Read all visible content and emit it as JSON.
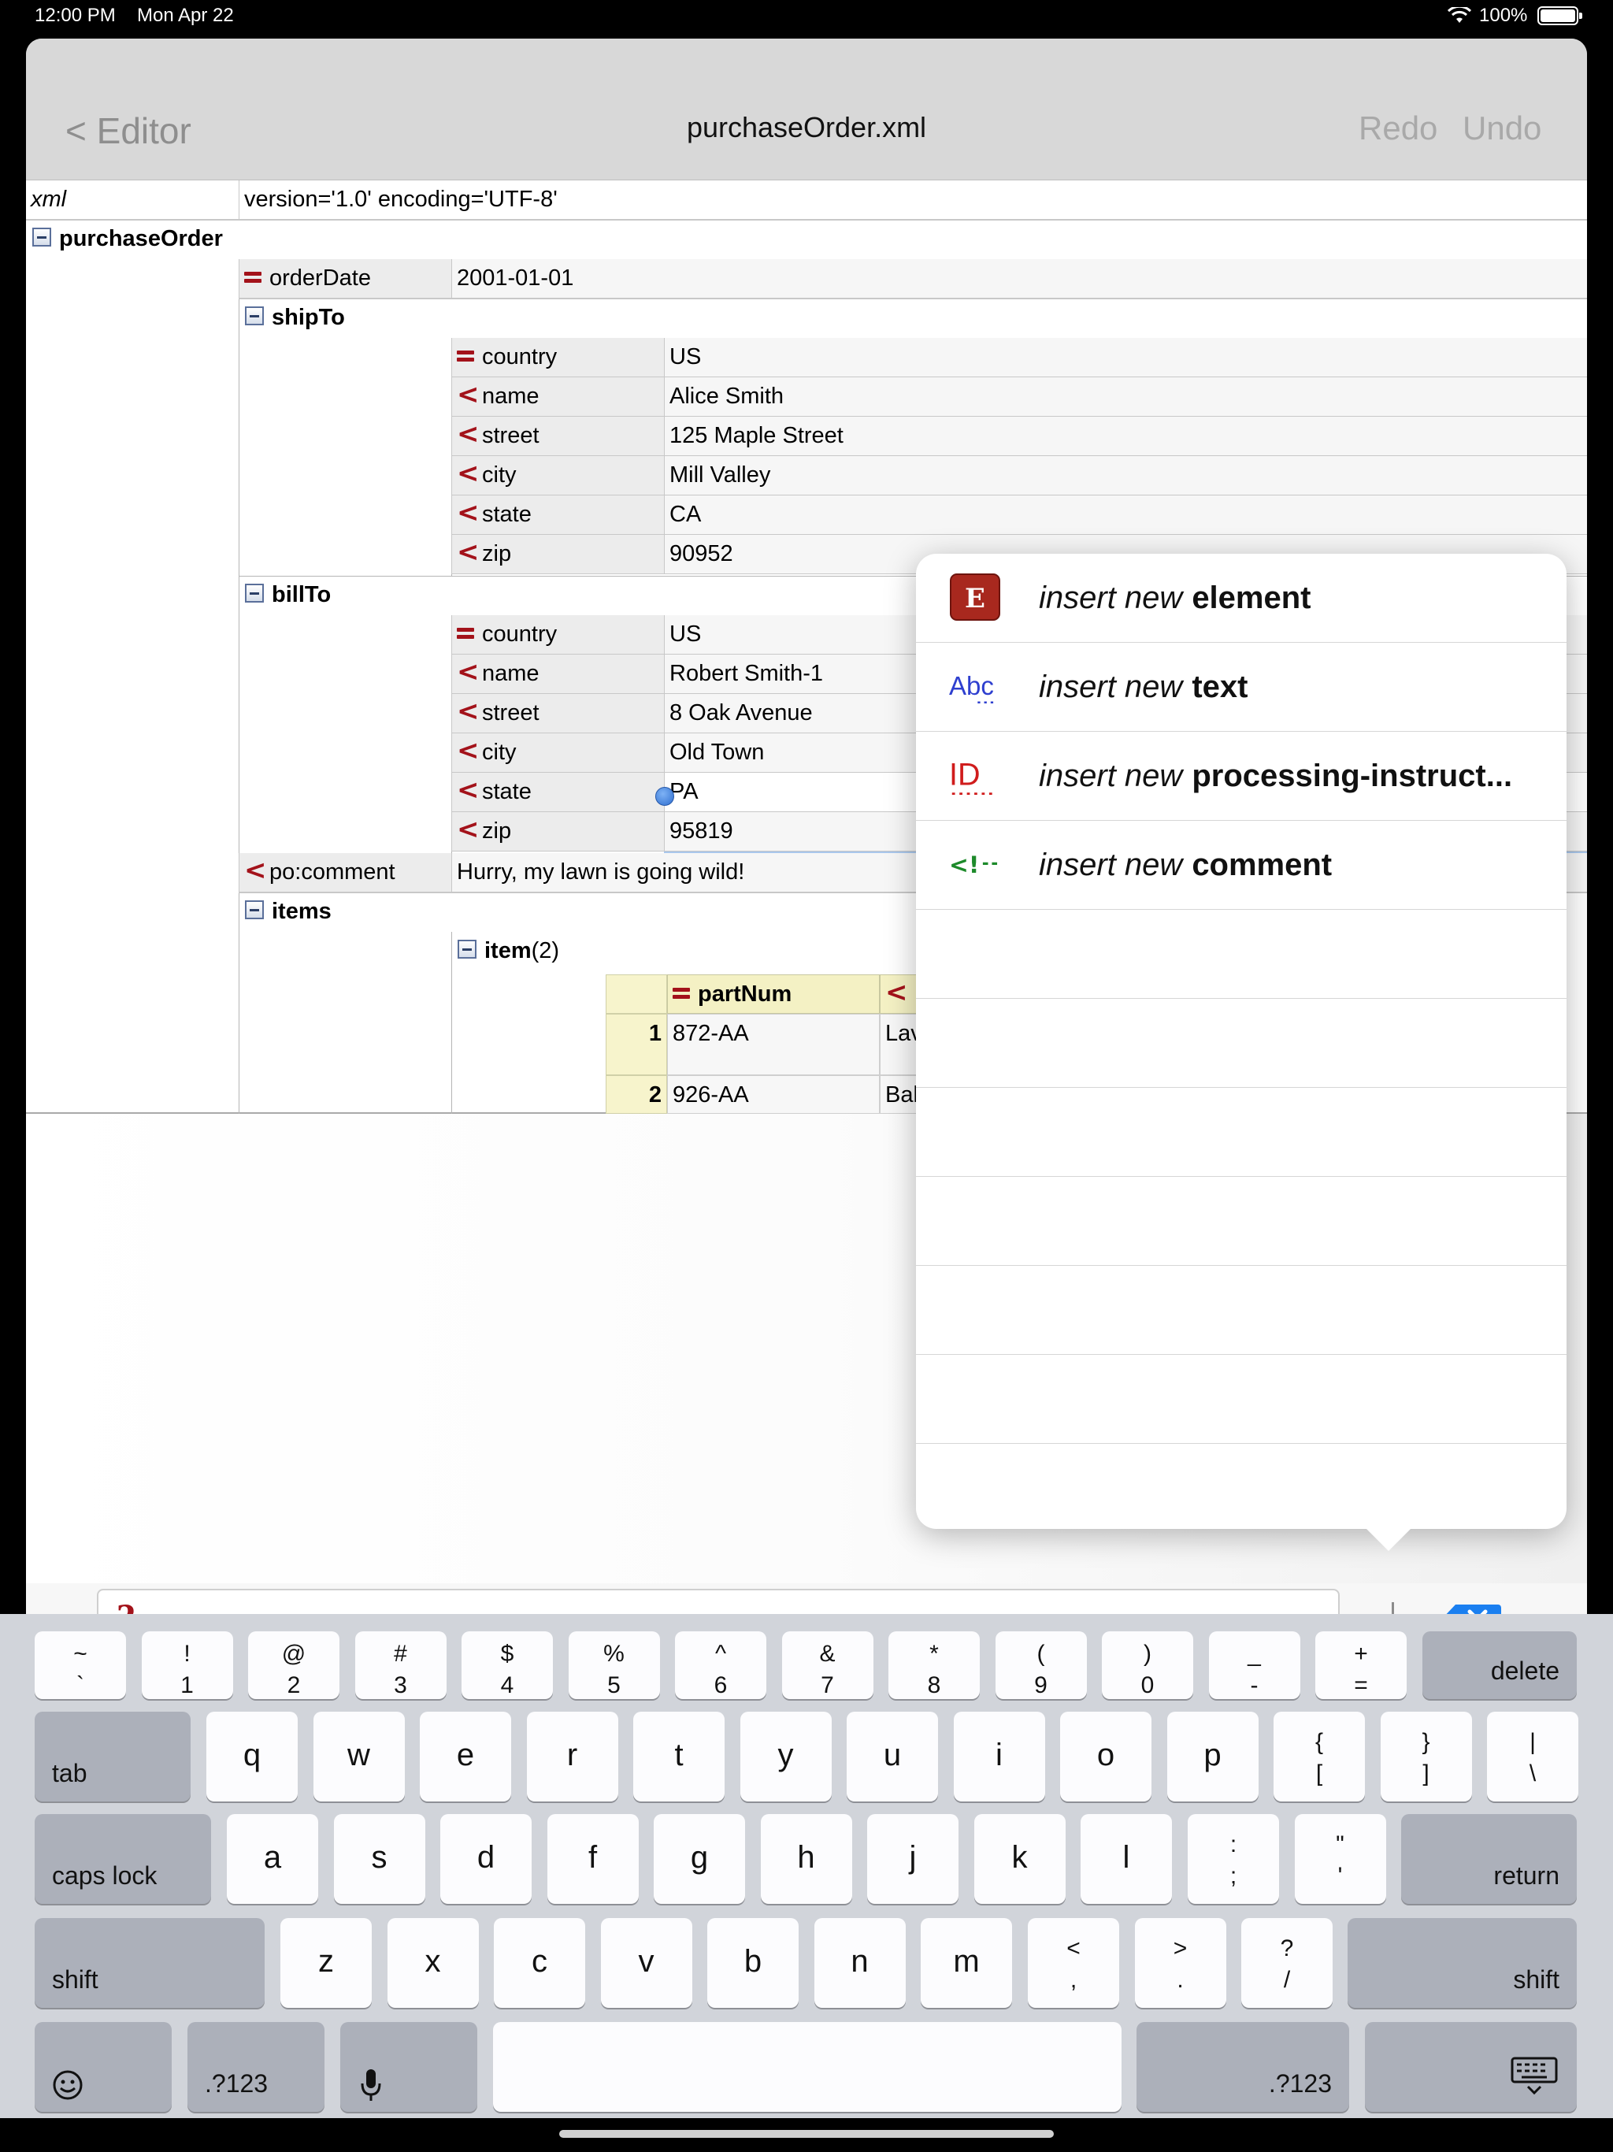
{
  "status": {
    "time": "12:00 PM",
    "date": "Mon Apr 22",
    "battery": "100%"
  },
  "nav": {
    "back": "< Editor",
    "title": "purchaseOrder.xml",
    "redo": "Redo",
    "undo": "Undo"
  },
  "xml": {
    "label": "xml",
    "value": "version='1.0' encoding='UTF-8'"
  },
  "tree": {
    "root": "purchaseOrder",
    "orderDate": {
      "name": "orderDate",
      "value": "2001-01-01"
    },
    "shipTo": {
      "label": "shipTo",
      "rows": [
        {
          "icon": "attribute-icon",
          "name": "country",
          "value": "US"
        },
        {
          "icon": "element-icon",
          "name": "name",
          "value": "Alice Smith"
        },
        {
          "icon": "element-icon",
          "name": "street",
          "value": "125 Maple Street"
        },
        {
          "icon": "element-icon",
          "name": "city",
          "value": "Mill Valley"
        },
        {
          "icon": "element-icon",
          "name": "state",
          "value": "CA"
        },
        {
          "icon": "element-icon",
          "name": "zip",
          "value": "90952"
        }
      ]
    },
    "billTo": {
      "label": "billTo",
      "rows": [
        {
          "icon": "attribute-icon",
          "name": "country",
          "value": "US"
        },
        {
          "icon": "element-icon",
          "name": "name",
          "value": "Robert Smith-1"
        },
        {
          "icon": "element-icon",
          "name": "street",
          "value": "8 Oak Avenue"
        },
        {
          "icon": "element-icon",
          "name": "city",
          "value": "Old Town"
        },
        {
          "icon": "element-icon",
          "name": "state",
          "value": "PA"
        },
        {
          "icon": "element-icon",
          "name": "zip",
          "value": "95819"
        }
      ]
    },
    "comment": {
      "name": "po:comment",
      "value": "Hurry, my lawn is going wild!"
    },
    "items": {
      "label": "items",
      "item_label": "item",
      "item_count": "(2)",
      "table": {
        "header": [
          "partNum"
        ],
        "rows": [
          {
            "index": "1",
            "partNum": "872-AA",
            "next": "Lav"
          },
          {
            "index": "2",
            "partNum": "926-AA",
            "next": "Bal"
          }
        ]
      }
    }
  },
  "popover": {
    "items": [
      {
        "icon": "element-e-icon",
        "prefix": "insert new",
        "label": "element"
      },
      {
        "icon": "text-abc-icon",
        "prefix": "insert new",
        "label": "text"
      },
      {
        "icon": "pi-id-icon",
        "prefix": "insert new",
        "label": "processing-instruct..."
      },
      {
        "icon": "comment-icon",
        "prefix": "insert new",
        "label": "comment"
      }
    ]
  },
  "input": {
    "value": ""
  },
  "keyboard": {
    "row1": [
      {
        "top": "~",
        "bot": "`"
      },
      {
        "top": "!",
        "bot": "1"
      },
      {
        "top": "@",
        "bot": "2"
      },
      {
        "top": "#",
        "bot": "3"
      },
      {
        "top": "$",
        "bot": "4"
      },
      {
        "top": "%",
        "bot": "5"
      },
      {
        "top": "^",
        "bot": "6"
      },
      {
        "top": "&",
        "bot": "7"
      },
      {
        "top": "*",
        "bot": "8"
      },
      {
        "top": "(",
        "bot": "9"
      },
      {
        "top": ")",
        "bot": "0"
      },
      {
        "top": "_",
        "bot": "-"
      },
      {
        "top": "+",
        "bot": "="
      }
    ],
    "delete": "delete",
    "tab": "tab",
    "row2": [
      "q",
      "w",
      "e",
      "r",
      "t",
      "y",
      "u",
      "i",
      "o",
      "p"
    ],
    "row2_sym": [
      {
        "top": "{",
        "bot": "["
      },
      {
        "top": "}",
        "bot": "]"
      },
      {
        "top": "|",
        "bot": "\\"
      }
    ],
    "caps": "caps lock",
    "row3": [
      "a",
      "s",
      "d",
      "f",
      "g",
      "h",
      "j",
      "k",
      "l"
    ],
    "row3_sym": [
      {
        "top": ":",
        "bot": ";"
      },
      {
        "top": "\"",
        "bot": "'"
      }
    ],
    "return": "return",
    "shift": "shift",
    "row4": [
      "z",
      "x",
      "c",
      "v",
      "b",
      "n",
      "m"
    ],
    "row4_sym": [
      {
        "top": "<",
        "bot": ","
      },
      {
        "top": ">",
        "bot": "."
      },
      {
        "top": "?",
        "bot": "/"
      }
    ],
    "numsym": ".?123"
  },
  "colors": {
    "accent_red": "#a3121a",
    "selection": "#a9c7ec",
    "nav_bg": "#d8d8d8",
    "keyboard_bg": "#d1d4da"
  }
}
